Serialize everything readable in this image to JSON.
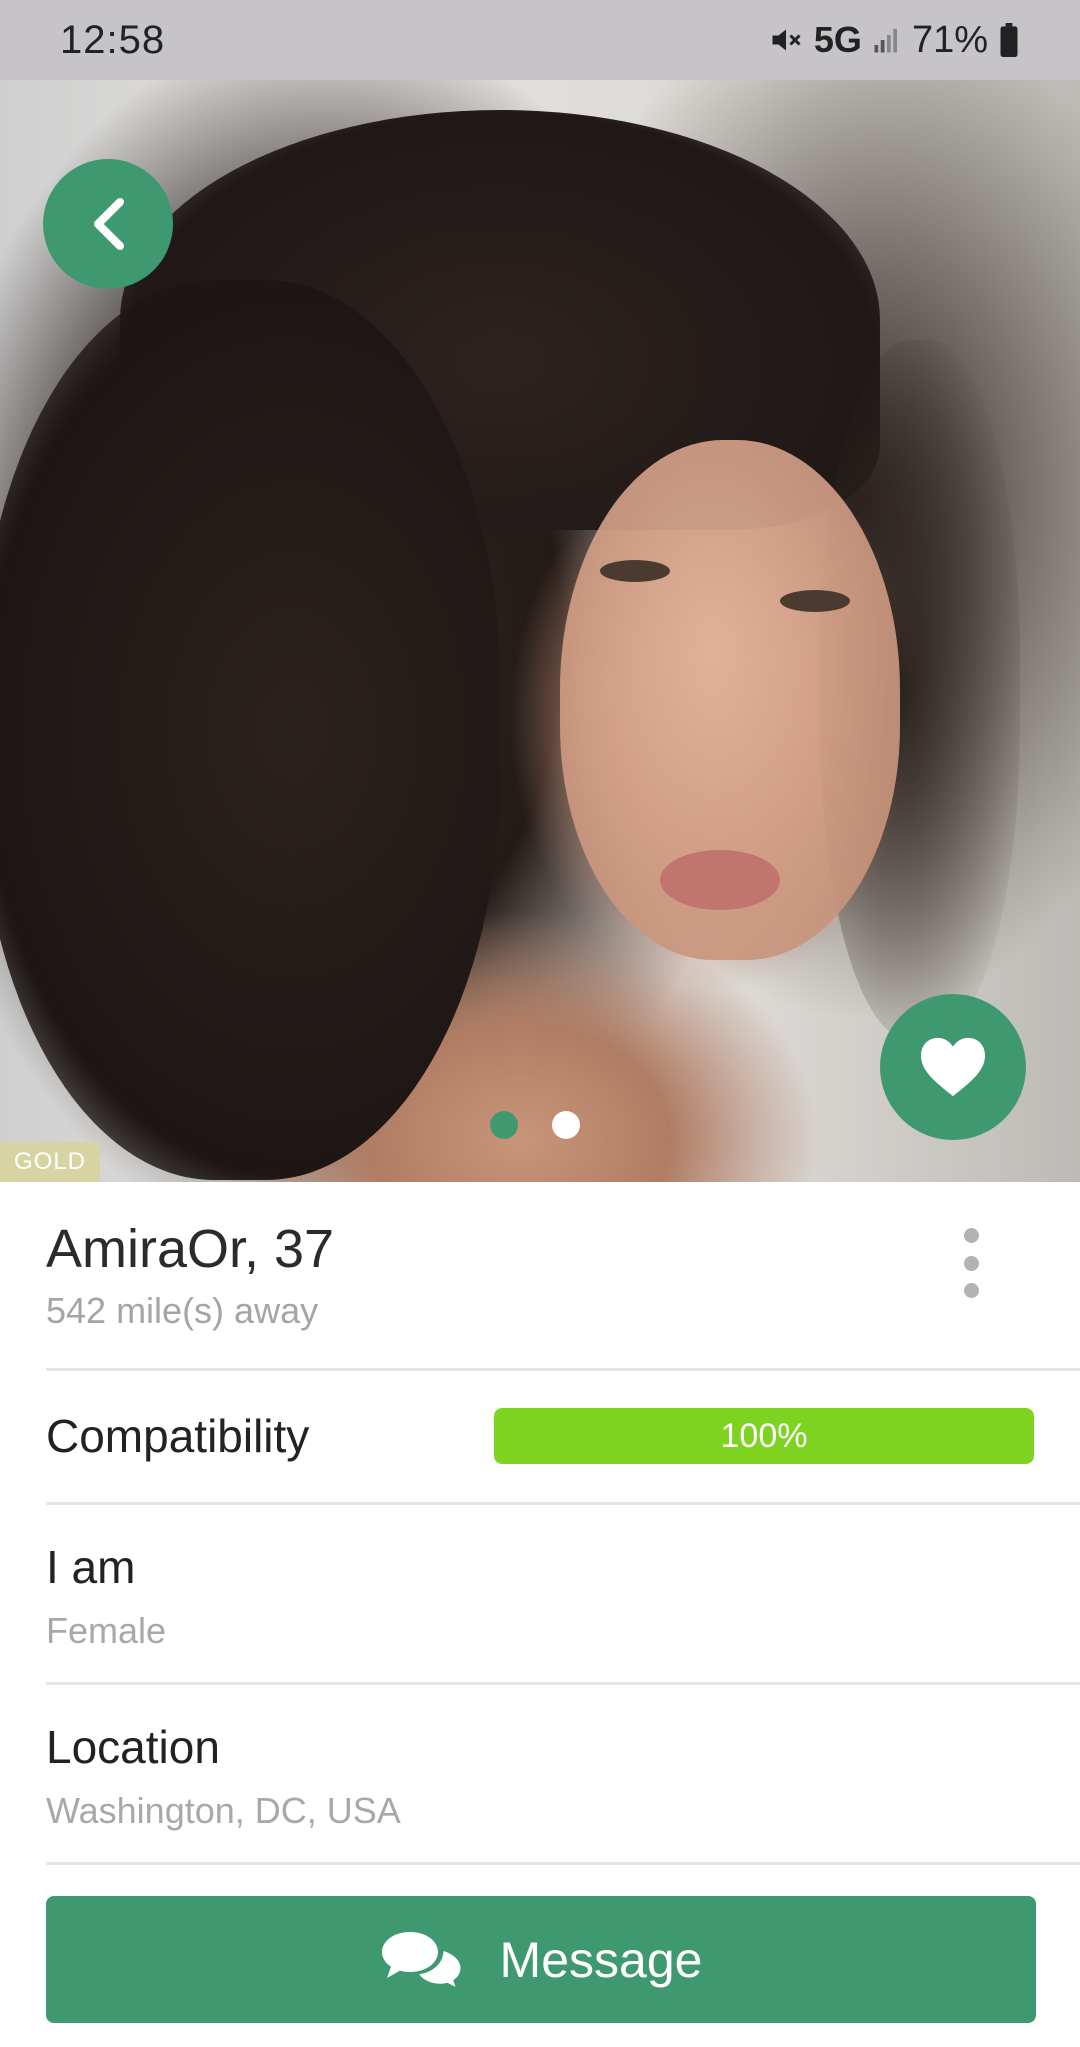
{
  "status_bar": {
    "time": "12:58",
    "network": "5G",
    "battery": "71%",
    "icons": [
      "mute-icon",
      "signal-icon",
      "battery-icon"
    ]
  },
  "photo": {
    "badge": "GOLD",
    "carousel_count": 2,
    "carousel_active_index": 0
  },
  "profile": {
    "name_age": "AmiraOr, 37",
    "distance": "542 mile(s) away"
  },
  "compatibility": {
    "label": "Compatibility",
    "value_text": "100%",
    "fraction": 1.0
  },
  "fields": [
    {
      "label": "I am",
      "value": "Female"
    },
    {
      "label": "Location",
      "value": "Washington, DC, USA"
    }
  ],
  "actions": {
    "message_label": "Message"
  },
  "colors": {
    "accent": "#3f9970",
    "compat_bar": "#7ed321",
    "gold_badge": "#d8d3a2",
    "status_bar": "#c6c4c9",
    "secondary_text": "#a5a5a5"
  }
}
